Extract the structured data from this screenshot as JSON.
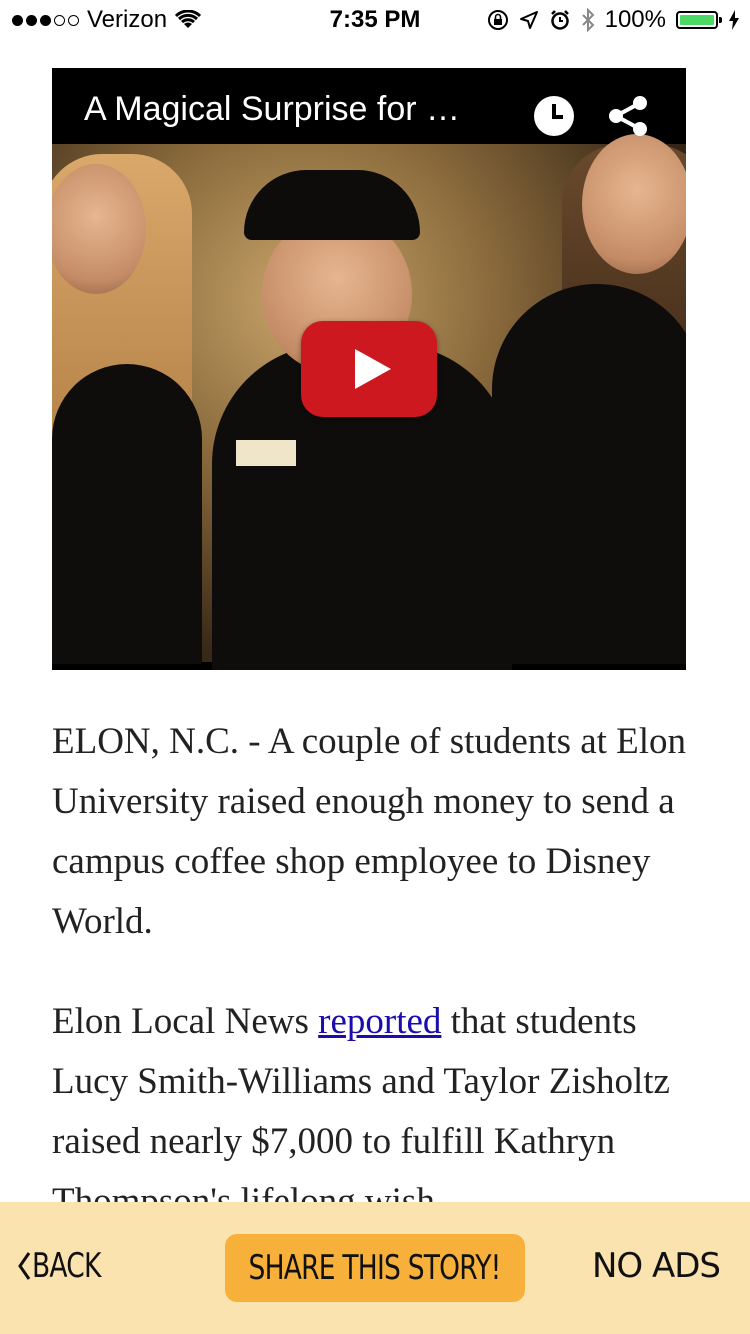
{
  "status_bar": {
    "carrier": "Verizon",
    "time": "7:35 PM",
    "battery_percent": "100%",
    "battery_level": 1.0,
    "signal_bars_filled": 3,
    "signal_bars_total": 5
  },
  "video": {
    "title": "A Magical Surprise for …",
    "play_icon": "play-icon",
    "watch_later_icon": "clock-icon",
    "share_icon": "share-icon",
    "play_color": "#cc181e"
  },
  "article": {
    "paragraph1": "ELON, N.C. - A couple of students at Elon University raised enough money to send a campus coffee shop employee to Disney World.",
    "paragraph2_before": "Elon Local News ",
    "paragraph2_link": "reported",
    "paragraph2_after": " that students Lucy Smith-Williams and Taylor Zisholtz raised nearly $7,000 to fulfill Kathryn Thompson's lifelong wish"
  },
  "bottom_bar": {
    "back_label": "BACK",
    "back_icon": "chevron-left-icon",
    "share_label": "SHARE THIS STORY!",
    "no_ads_label": "NO ADS",
    "background": "#fbe3b0",
    "share_color": "#f7b13a"
  }
}
